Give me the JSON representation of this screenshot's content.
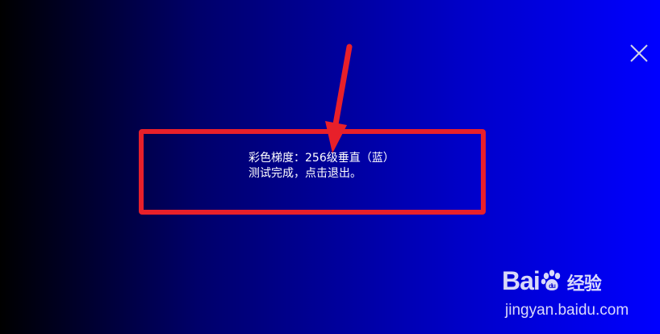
{
  "dialog": {
    "line1": "彩色梯度：256级垂直（蓝）",
    "line2": "测试完成，点击退出。"
  },
  "watermark": {
    "logo_part1": "Bai",
    "logo_part2": "经验",
    "url": "jingyan.baidu.com"
  },
  "colors": {
    "gradient_start": "#000000",
    "gradient_end": "#0000ff",
    "annotation": "#e8202a",
    "text": "#ffffff"
  },
  "icons": {
    "close": "close-icon",
    "paw": "baidu-paw-icon"
  }
}
